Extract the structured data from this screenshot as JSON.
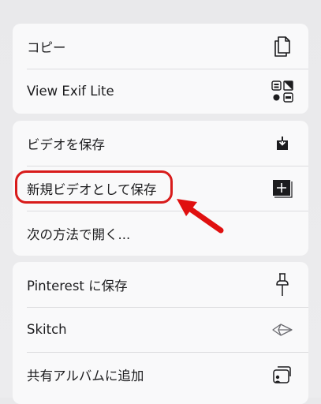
{
  "groups": [
    {
      "items": [
        {
          "label": "コピー",
          "icon": "copy-icon"
        },
        {
          "label": "View Exif Lite",
          "icon": "exif-grid-icon"
        }
      ]
    },
    {
      "items": [
        {
          "label": "ビデオを保存",
          "icon": "save-download-icon"
        },
        {
          "label": "新規ビデオとして保存",
          "icon": "plus-square-icon"
        },
        {
          "label": "次の方法で開く...",
          "icon": ""
        }
      ]
    },
    {
      "items": [
        {
          "label": "Pinterest に保存",
          "icon": "pushpin-icon"
        },
        {
          "label": "Skitch",
          "icon": "skitch-arrow-icon"
        },
        {
          "label": "共有アルバムに追加",
          "icon": "shared-album-icon"
        }
      ]
    }
  ],
  "colors": {
    "highlight": "#d81b1b",
    "background": "#e9e9eb",
    "card": "#f9f9fa"
  }
}
